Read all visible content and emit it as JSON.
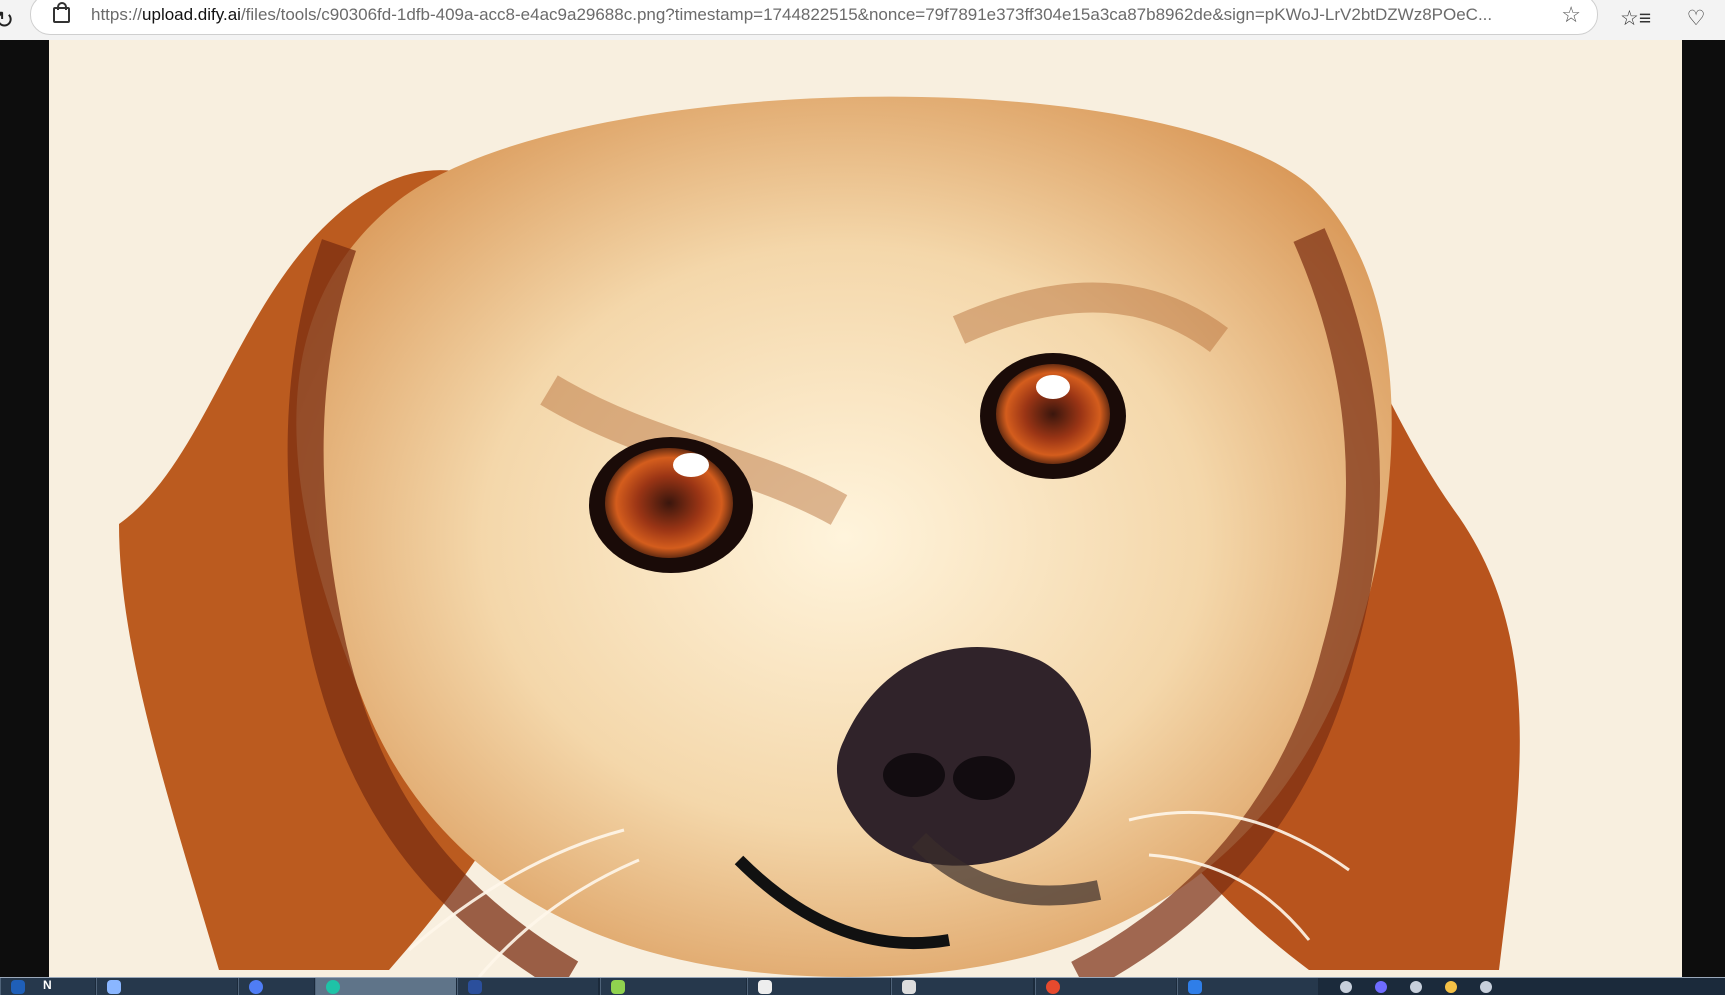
{
  "browser": {
    "url_prefix": "https://",
    "url_host": "upload.dify.ai",
    "url_path": "/files/tools/c90306fd-1dfb-409a-acc8-e4ac9a29688c.png?timestamp=1744822515&nonce=79f7891e373ff304e15a3ca87b8962de&sign=pKWoJ-LrV2btDZWz8POeC..."
  },
  "image": {
    "description": "dog portrait illustration"
  },
  "taskbar": {
    "items": [
      "N",
      "",
      "",
      "",
      "",
      "",
      "",
      "",
      "",
      ""
    ]
  }
}
